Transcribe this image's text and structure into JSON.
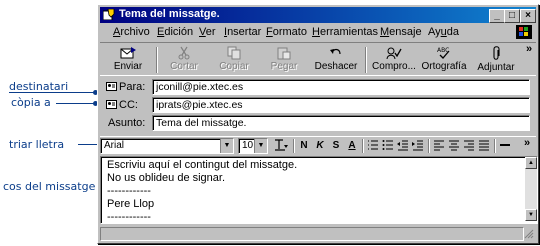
{
  "annotations": {
    "recipients": "destinatari",
    "copy_to": "còpia a",
    "choose_font": "triar lletra",
    "message_body": "cos del missatge"
  },
  "window": {
    "title": "Tema del missatge.",
    "controls": {
      "minimize": "_",
      "maximize": "□",
      "close": "×"
    }
  },
  "menu": [
    {
      "pre": "",
      "ul": "A",
      "post": "rchivo"
    },
    {
      "pre": "",
      "ul": "E",
      "post": "dición"
    },
    {
      "pre": "",
      "ul": "V",
      "post": "er"
    },
    {
      "pre": "",
      "ul": "I",
      "post": "nsertar"
    },
    {
      "pre": "",
      "ul": "F",
      "post": "ormato"
    },
    {
      "pre": "",
      "ul": "H",
      "post": "erramientas"
    },
    {
      "pre": "",
      "ul": "M",
      "post": "ensaje"
    },
    {
      "pre": "Ay",
      "ul": "u",
      "post": "da"
    }
  ],
  "toolbar": {
    "send": "Enviar",
    "cut": "Cortar",
    "copy": "Copiar",
    "paste": "Pegar",
    "undo": "Deshacer",
    "check": "Compro...",
    "spelling": "Ortografía",
    "attach": "Adjuntar",
    "more": "»"
  },
  "header": {
    "to_label": "Para:",
    "to_value": "jconill@pie.xtec.es",
    "cc_label": "CC:",
    "cc_value": "iprats@pie.xtec.es",
    "subject_label": "Asunto:",
    "subject_value": "Tema del missatge."
  },
  "format": {
    "font": "Arial",
    "size": "10",
    "bold": "N",
    "italic": "K",
    "underline": "S",
    "font_color": "A",
    "more": "»"
  },
  "body": [
    "Escriviu aquí el contingut del missatge.",
    "No us oblideu de signar.",
    "------------",
    "Pere Llop",
    "------------"
  ]
}
